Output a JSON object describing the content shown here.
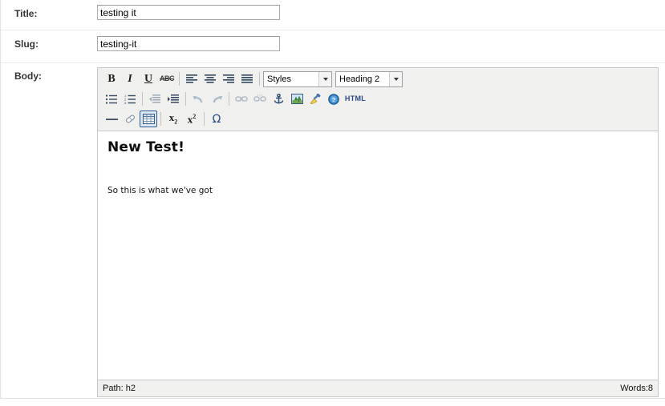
{
  "form": {
    "rows": [
      {
        "label": "Title:",
        "value": "testing it",
        "placeholder": ""
      },
      {
        "label": "Slug:",
        "value": "testing-it",
        "placeholder": ""
      },
      {
        "label": "Body:"
      }
    ]
  },
  "editor": {
    "toolbar_row1": [
      {
        "name": "bold-icon",
        "glyph": "B",
        "style": "bold-i",
        "disabled": false
      },
      {
        "name": "italic-icon",
        "glyph": "I",
        "style": "ital-i",
        "disabled": false
      },
      {
        "name": "underline-icon",
        "glyph": "U",
        "style": "und-i",
        "disabled": false
      },
      {
        "name": "strikethrough-icon",
        "glyph": "ABC",
        "style": "strike-i",
        "disabled": false
      },
      {
        "name": "separator",
        "glyph": "",
        "style": "sep",
        "disabled": false
      },
      {
        "name": "align-left-icon",
        "glyph": "",
        "style": "align-left",
        "disabled": false
      },
      {
        "name": "align-center-icon",
        "glyph": "",
        "style": "align-center",
        "disabled": false
      },
      {
        "name": "align-right-icon",
        "glyph": "",
        "style": "align-right",
        "disabled": false
      },
      {
        "name": "align-justify-icon",
        "glyph": "",
        "style": "align-justify",
        "disabled": false
      }
    ],
    "select_styles": {
      "label": "Styles",
      "name": "styles-select"
    },
    "select_format": {
      "label": "Heading 2",
      "name": "format-select"
    },
    "toolbar_row2": [
      {
        "name": "bullet-list-icon"
      },
      {
        "name": "numbered-list-icon"
      },
      {
        "name": "separator"
      },
      {
        "name": "outdent-icon"
      },
      {
        "name": "indent-icon"
      },
      {
        "name": "separator"
      },
      {
        "name": "undo-icon"
      },
      {
        "name": "redo-icon"
      },
      {
        "name": "separator"
      },
      {
        "name": "link-icon"
      },
      {
        "name": "unlink-icon"
      },
      {
        "name": "anchor-icon"
      },
      {
        "name": "image-icon"
      },
      {
        "name": "cleanup-broom-icon"
      },
      {
        "name": "help-icon"
      },
      {
        "name": "html-source-icon"
      }
    ],
    "html_button_label": "HTML",
    "toolbar_row3": [
      {
        "name": "horizontal-rule-icon"
      },
      {
        "name": "remove-format-eraser-icon"
      },
      {
        "name": "table-icon"
      },
      {
        "name": "separator"
      },
      {
        "name": "subscript-icon"
      },
      {
        "name": "superscript-icon"
      },
      {
        "name": "separator"
      },
      {
        "name": "special-character-icon"
      }
    ],
    "subscript_glyph": "x",
    "subscript_small": "2",
    "superscript_glyph": "x",
    "superscript_small": "2",
    "omega_glyph": "Ω",
    "content": {
      "heading": "New Test!",
      "paragraph": "So this is what we've got"
    },
    "statusbar": {
      "path": "Path: h2",
      "words": "Words:8"
    }
  },
  "colors": {
    "toolbar_bg": "#f0f0ee",
    "editor_border": "#c7c7c7",
    "active_border": "#2c5c92",
    "accent_blue": "#2b4a86"
  }
}
